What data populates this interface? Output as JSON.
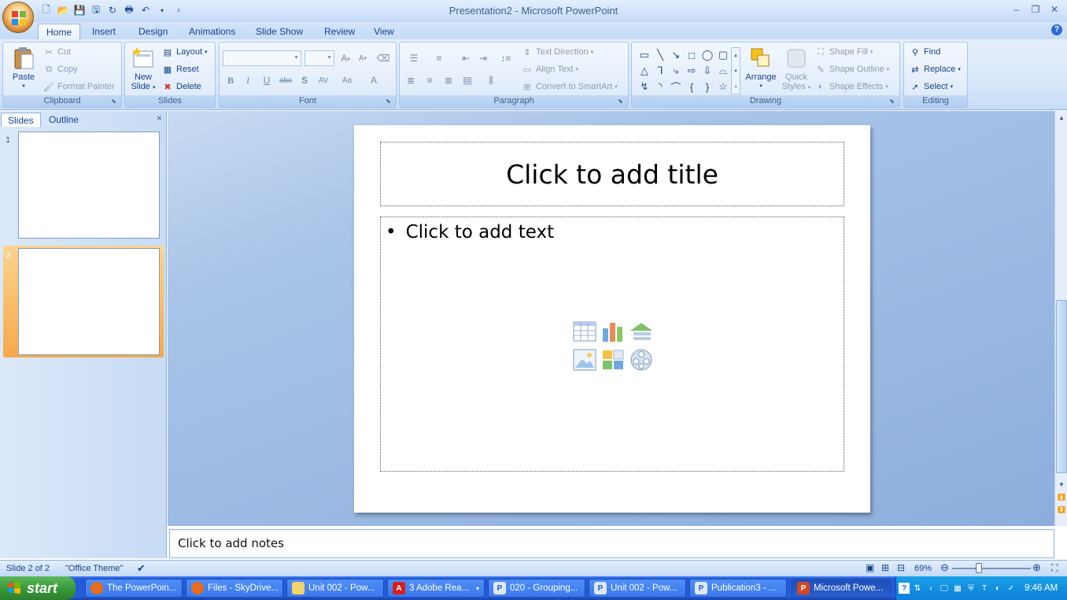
{
  "window": {
    "title": "Presentation2 - Microsoft PowerPoint"
  },
  "tabs": [
    "Home",
    "Insert",
    "Design",
    "Animations",
    "Slide Show",
    "Review",
    "View"
  ],
  "ribbon": {
    "clipboard": {
      "label": "Clipboard",
      "paste": "Paste",
      "cut": "Cut",
      "copy": "Copy",
      "format_painter": "Format Painter"
    },
    "slides": {
      "label": "Slides",
      "new_slide_line1": "New",
      "new_slide_line2": "Slide",
      "layout": "Layout",
      "reset": "Reset",
      "delete": "Delete"
    },
    "font": {
      "label": "Font",
      "bold": "B",
      "italic": "I",
      "underline": "U",
      "strike": "abc",
      "shadow": "S",
      "spacing": "AV",
      "case": "Aa",
      "color": "A"
    },
    "paragraph": {
      "label": "Paragraph",
      "text_direction": "Text Direction",
      "align_text": "Align Text",
      "convert_smartart": "Convert to SmartArt"
    },
    "drawing": {
      "label": "Drawing",
      "arrange": "Arrange",
      "quick_styles_line1": "Quick",
      "quick_styles_line2": "Styles",
      "shape_fill": "Shape Fill",
      "shape_outline": "Shape Outline",
      "shape_effects": "Shape Effects"
    },
    "editing": {
      "label": "Editing",
      "find": "Find",
      "replace": "Replace",
      "select": "Select"
    }
  },
  "pane": {
    "tab_slides": "Slides",
    "tab_outline": "Outline",
    "close": "×",
    "thumb1": "1",
    "thumb2": "2"
  },
  "slide": {
    "title_placeholder": "Click to add title",
    "body_placeholder": "Click to add text",
    "bullet": "•"
  },
  "notes": {
    "placeholder": "Click to add notes"
  },
  "status": {
    "slide_info": "Slide 2 of 2",
    "theme": "\"Office Theme\"",
    "zoom": "69%"
  },
  "taskbar": {
    "start": "start",
    "items": [
      "The PowerPoin...",
      "Files - SkyDrive...",
      "Unit 002 - Pow...",
      "3 Adobe Rea...",
      "020 - Grouping...",
      "Unit 002 - Pow...",
      "Publication3 - ...",
      "Microsoft Powe..."
    ],
    "time": "9:46 AM"
  }
}
